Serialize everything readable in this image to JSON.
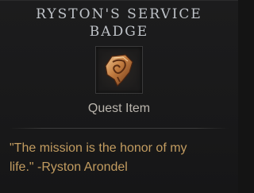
{
  "item": {
    "name_line1": "RYSTON'S SERVICE",
    "name_line2": "BADGE",
    "icon": "service-badge-icon",
    "type": "Quest Item",
    "flavor_line1": "\"The mission is the honor of my",
    "flavor_line2": "life.\" -Ryston Arondel"
  },
  "colors": {
    "title": "#bfc3c8",
    "type_label": "#b9b4ac",
    "flavor_text": "#c29c60",
    "background": "#1a1a1b"
  }
}
